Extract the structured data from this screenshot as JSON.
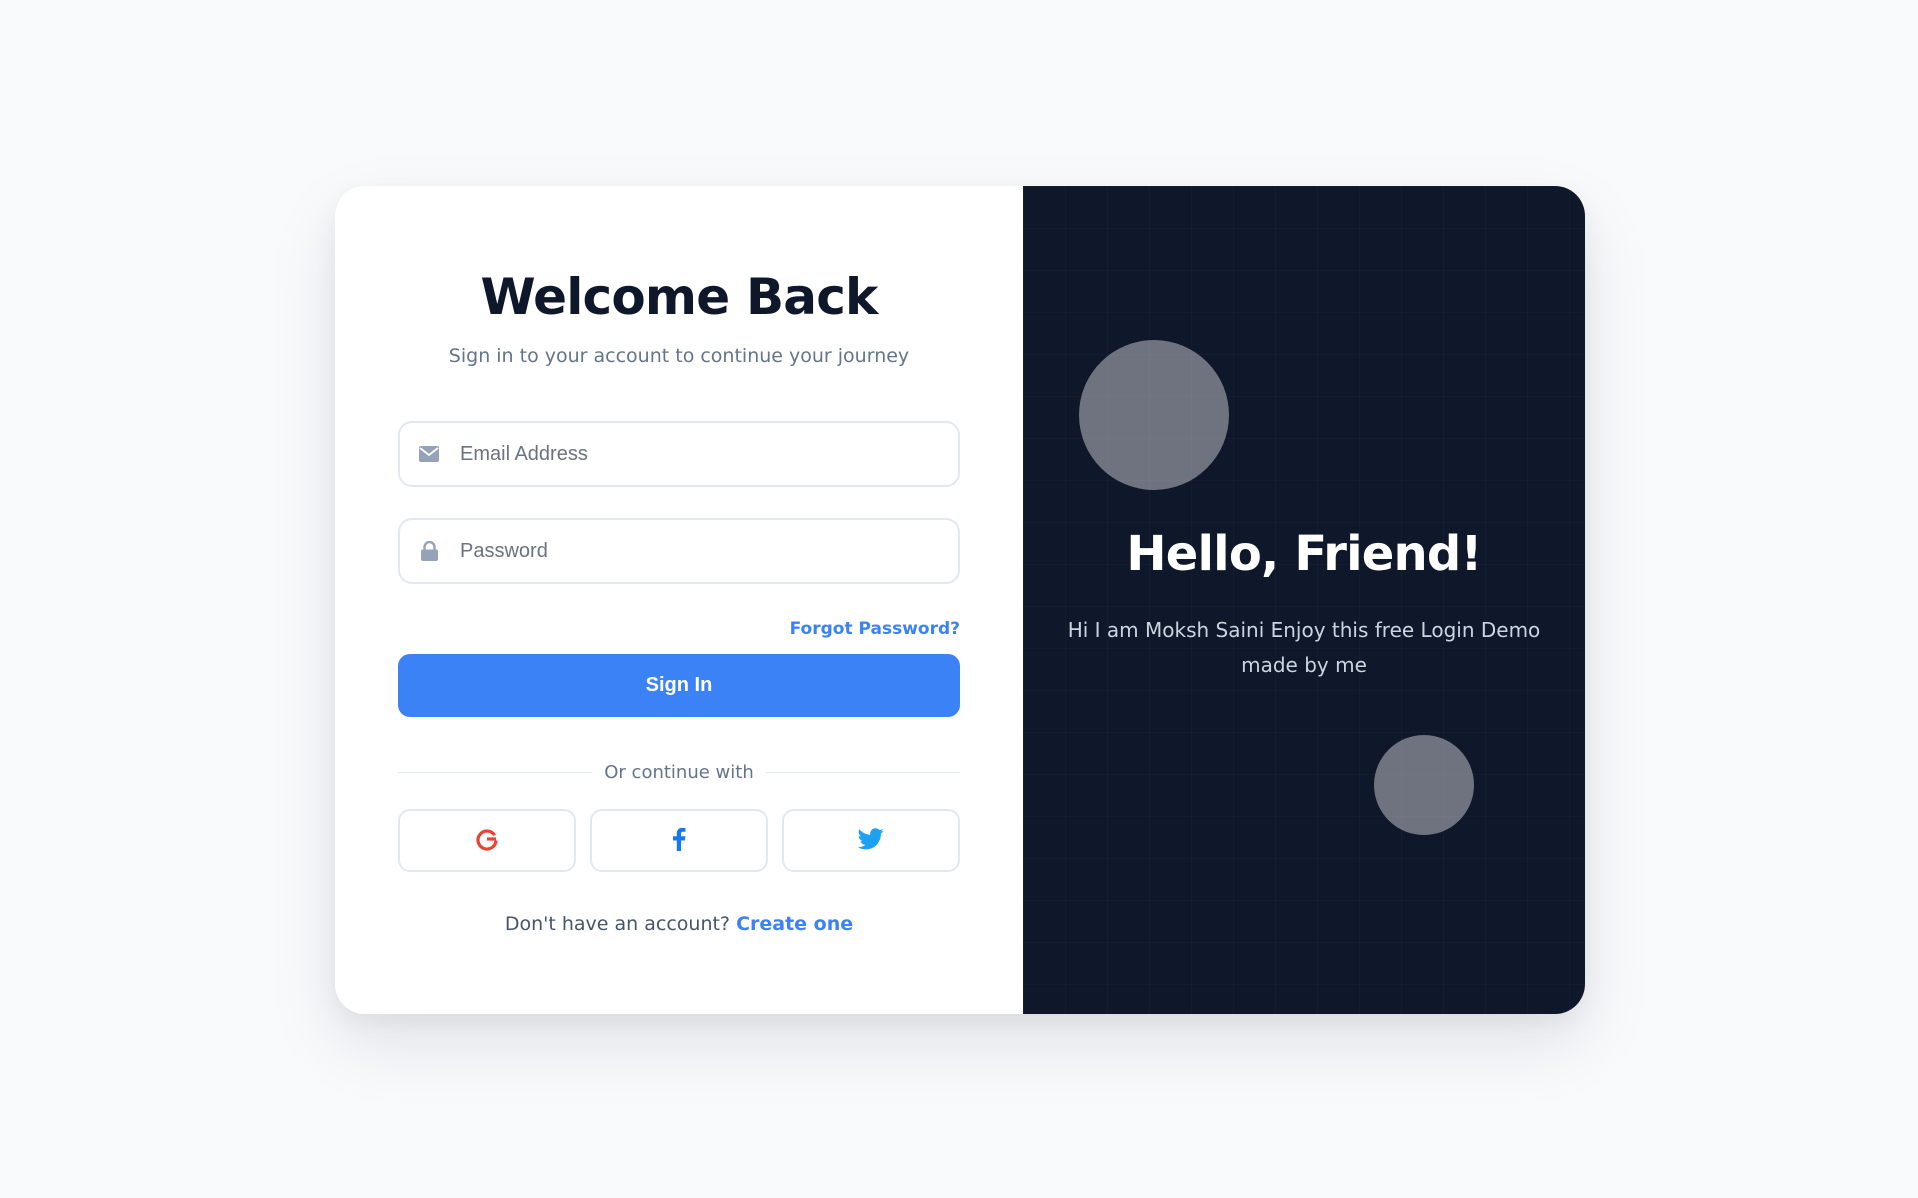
{
  "login": {
    "title": "Welcome Back",
    "subtitle": "Sign in to your account to continue your journey",
    "email_placeholder": "Email Address",
    "password_placeholder": "Password",
    "forgot_password": "Forgot Password?",
    "sign_in": "Sign In",
    "divider_text": "Or continue with",
    "socials": [
      {
        "name": "Google",
        "icon": "google-icon",
        "color": "#ea4335"
      },
      {
        "name": "Facebook",
        "icon": "facebook-icon",
        "color": "#1877f2"
      },
      {
        "name": "Twitter",
        "icon": "twitter-icon",
        "color": "#1da1f2"
      }
    ],
    "signup_prompt": "Don't have an account?",
    "signup_link": "Create one"
  },
  "welcome_panel": {
    "title": "Hello, Friend!",
    "message": "Hi I am Moksh Saini Enjoy this free Login Demo made by me"
  },
  "colors": {
    "accent": "#3b82f6",
    "panel_bg": "#0f172a",
    "text_dark": "#0f172a",
    "text_muted": "#64748b",
    "border": "#e2e8f0"
  }
}
